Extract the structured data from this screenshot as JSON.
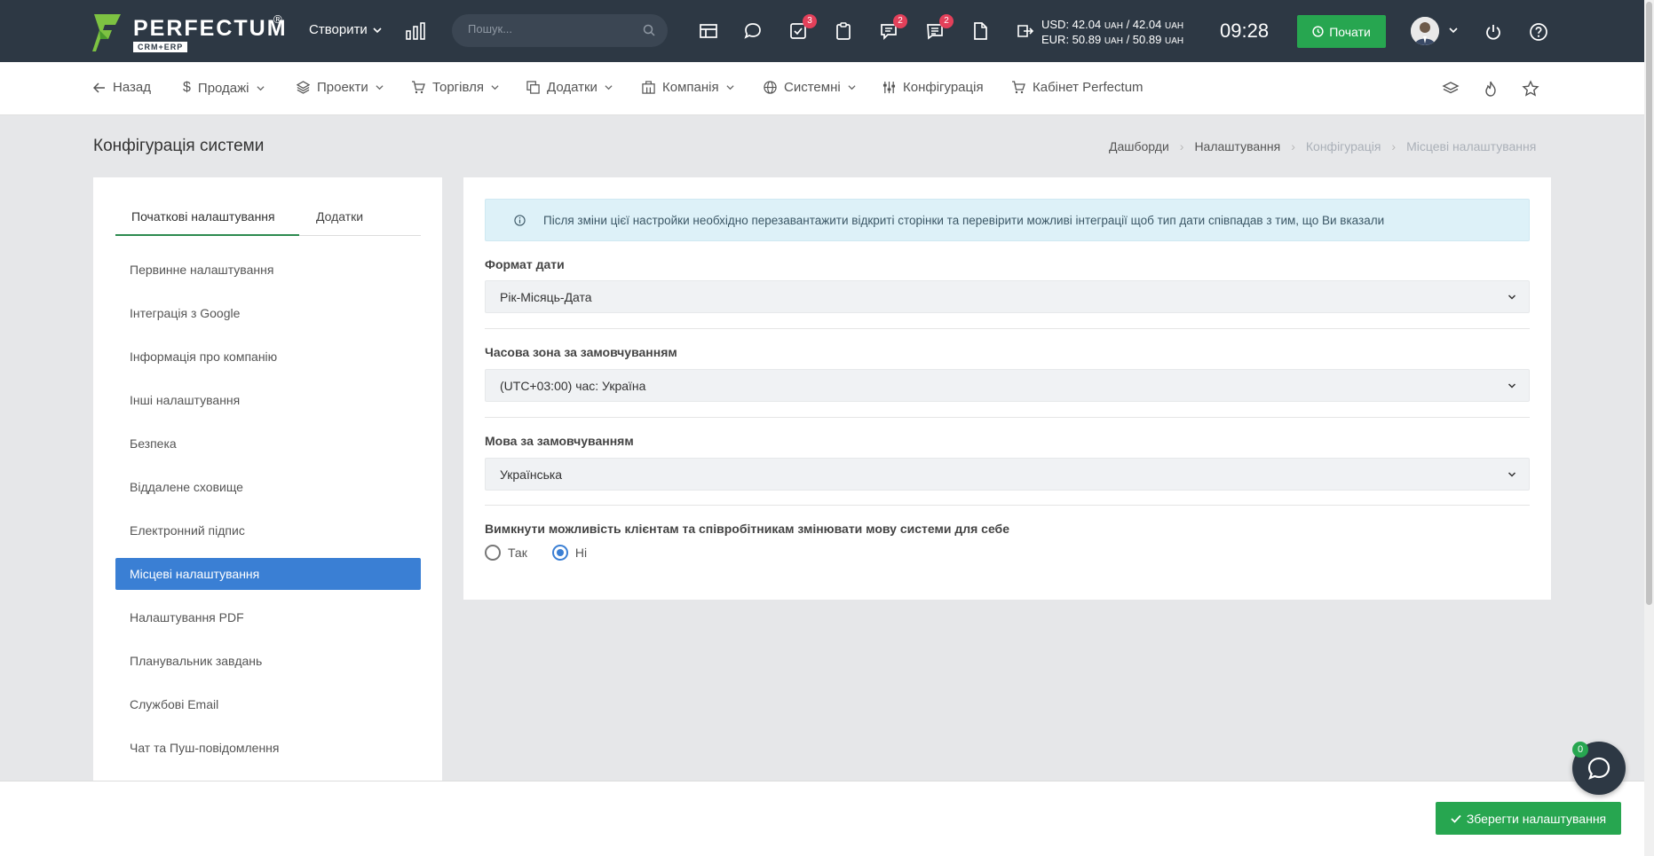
{
  "header": {
    "logo_text": "PERFECTUM",
    "logo_reg": "®",
    "logo_sub": "CRM+ERP",
    "create_label": "Створити",
    "search_placeholder": "Пошук...",
    "badges": {
      "tasks": "3",
      "chat": "2",
      "notes": "2"
    },
    "currency_usd": "USD: 42.04",
    "currency_usd_rate": "/ 42.04",
    "currency_eur": "EUR: 50.89",
    "currency_eur_rate": "/ 50.89",
    "currency_unit": "UAH",
    "time": "09:28",
    "start_label": "Почати"
  },
  "nav": {
    "back": "Назад",
    "sales": "Продажі",
    "projects": "Проекти",
    "trade": "Торгівля",
    "addons": "Додатки",
    "company": "Компанія",
    "system": "Системні",
    "config": "Конфігурація",
    "cabinet": "Кабінет Perfectum"
  },
  "page": {
    "title": "Конфігурація системи",
    "breadcrumb": [
      "Дашборди",
      "Налаштування",
      "Конфігурація",
      "Місцеві налаштування"
    ]
  },
  "sidebar": {
    "tabs": [
      "Початкові налаштування",
      "Додатки"
    ],
    "items": [
      "Первинне налаштування",
      "Інтеграція з Google",
      "Інформація про компанію",
      "Інші налаштування",
      "Безпека",
      "Віддалене сховище",
      "Електронний підпис",
      "Місцеві налаштування",
      "Налаштування PDF",
      "Планувальник завдань",
      "Службові Email",
      "Чат та Пуш-повідомлення"
    ]
  },
  "settings": {
    "alert": "Після зміни цієї настройки необхідно перезавантажити відкриті сторінки та перевірити можливі інтеграції щоб тип дати співпадав з тим, що Ви вказали",
    "date_format_label": "Формат дати",
    "date_format_value": "Рік-Місяць-Дата",
    "timezone_label": "Часова зона за замовчуванням",
    "timezone_value": "(UTC+03:00) час: Україна",
    "language_label": "Мова за замовчуванням",
    "language_value": "Українська",
    "disable_lang_label": "Вимкнути можливість клієнтам та співробітникам змінювати мову системи для себе",
    "option_yes": "Так",
    "option_no": "Ні",
    "selected_option": "Ні"
  },
  "footer": {
    "save_label": "Зберегти налаштування",
    "chat_badge": "0"
  },
  "colors": {
    "header_bg": "#2d3844",
    "accent_green": "#27a650",
    "active_blue": "#3a7fd4",
    "badge_red": "#e3405a",
    "alert_bg": "#ddf1f8"
  }
}
